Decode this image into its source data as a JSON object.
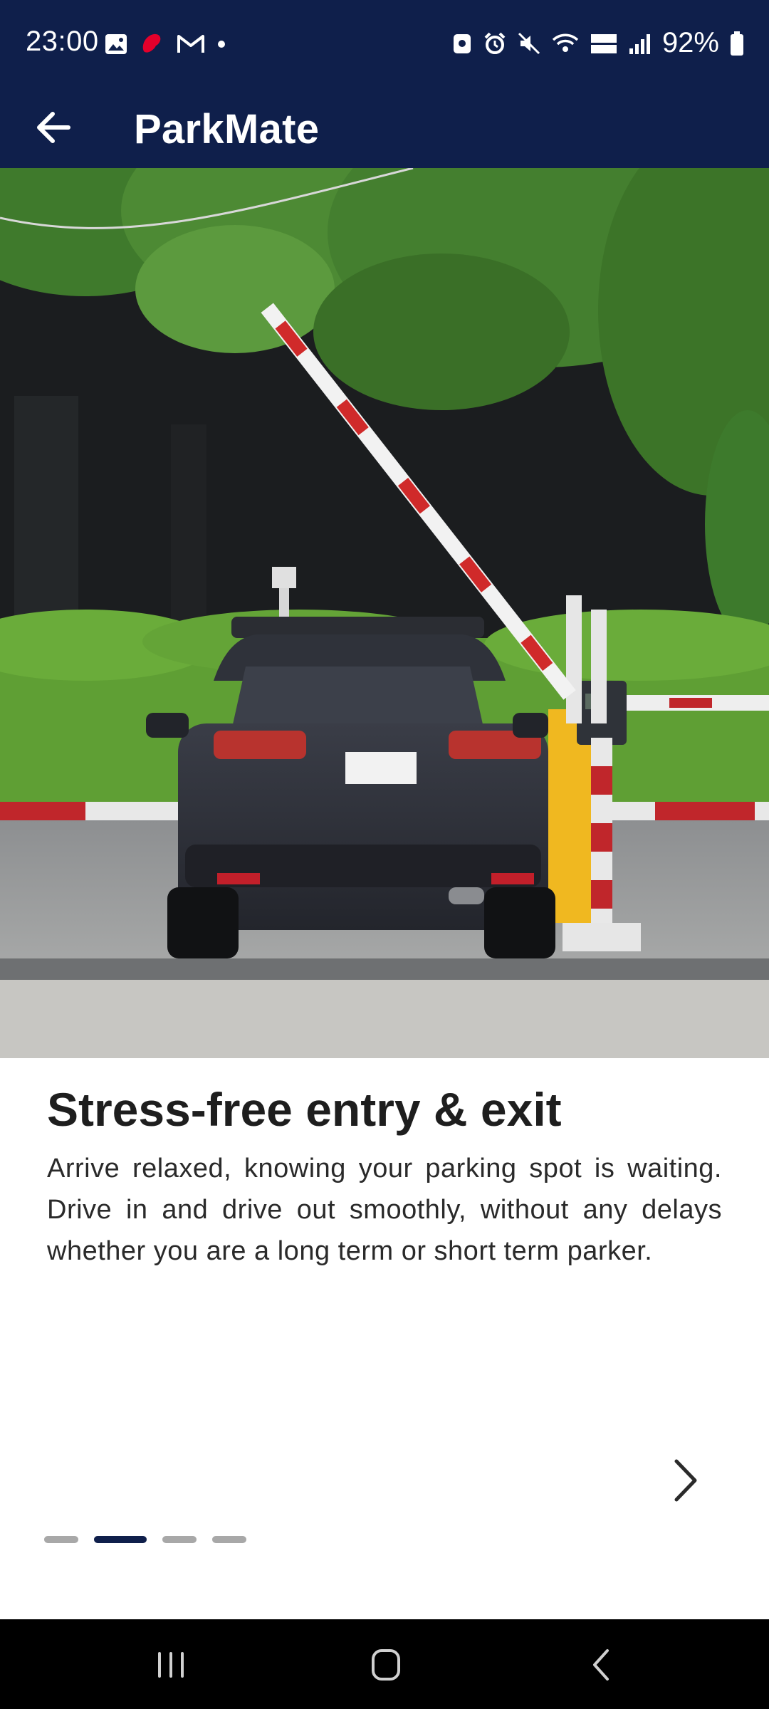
{
  "status_bar": {
    "time": "23:00",
    "battery": "92%",
    "left_icons": [
      "gallery-icon",
      "airtel-icon",
      "gmail-icon",
      "notification-dot-icon"
    ],
    "right_icons": [
      "nfc-lock-icon",
      "alarm-icon",
      "mute-icon",
      "wifi-icon",
      "volte-icon",
      "signal-icon",
      "battery-icon"
    ]
  },
  "app_bar": {
    "title": "ParkMate",
    "back_icon": "arrow-left-icon"
  },
  "hero_image": {
    "subject": "car-at-parking-barrier"
  },
  "onboarding": {
    "headline": "Stress-free entry & exit",
    "description": "Arrive relaxed, knowing your parking spot is waiting. Drive in and drive out smoothly, without any delays whether you are a long term or short term parker.",
    "next_icon": "chevron-right-icon",
    "page_count": 4,
    "active_page": 2
  },
  "nav_bar": {
    "items": [
      "recents-icon",
      "home-icon",
      "back-icon"
    ]
  },
  "colors": {
    "primary": "#0f1f4b",
    "indicator_inactive": "#a8a8a8",
    "text": "#1e1e1e"
  }
}
